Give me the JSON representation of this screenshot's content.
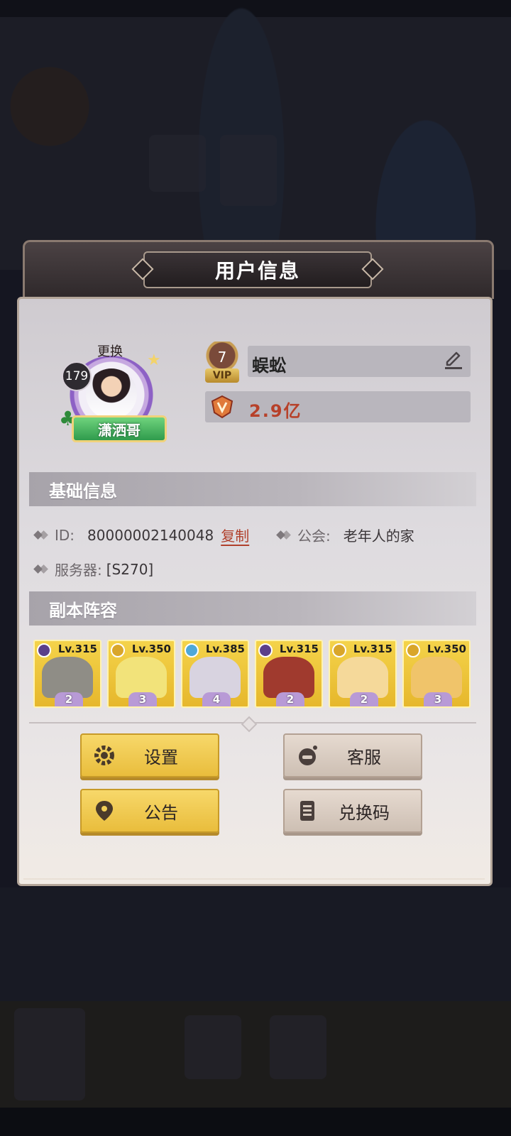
{
  "dialog": {
    "title": "用户信息"
  },
  "profile": {
    "avatar_change_label": "更换",
    "avatar_level": "179",
    "title_banner": "潇洒哥",
    "vip_level": "7",
    "vip_label": "VIP",
    "player_name": "蜈蚣",
    "power": "2.9亿"
  },
  "basic_info": {
    "header": "基础信息",
    "id_label": "ID:",
    "id_value": "80000002140048",
    "copy_label": "复制",
    "guild_label": "公会:",
    "guild_value": "老年人的家",
    "server_label": "服务器:",
    "server_value": "[S270]"
  },
  "dungeon_lineup": {
    "header": "副本阵容",
    "heroes": [
      {
        "level": "Lv.315",
        "stars": "2",
        "faction": "dark",
        "art_color": "#8f8d86"
      },
      {
        "level": "Lv.350",
        "stars": "3",
        "faction": "gold",
        "art_color": "#f2e37a"
      },
      {
        "level": "Lv.385",
        "stars": "4",
        "faction": "light",
        "art_color": "#d8d3e0"
      },
      {
        "level": "Lv.315",
        "stars": "2",
        "faction": "dark",
        "art_color": "#a03a2e"
      },
      {
        "level": "Lv.315",
        "stars": "2",
        "faction": "gold",
        "art_color": "#f5d99a"
      },
      {
        "level": "Lv.350",
        "stars": "3",
        "faction": "gold",
        "art_color": "#f0c46a"
      }
    ]
  },
  "buttons": {
    "settings": "设置",
    "customer_service": "客服",
    "announcement": "公告",
    "redeem_code": "兑换码"
  },
  "colors": {
    "gold_button": "#f2cf58",
    "beige_button": "#dccfc4",
    "power_text": "#b7412a",
    "copy_link": "#b0402c"
  }
}
